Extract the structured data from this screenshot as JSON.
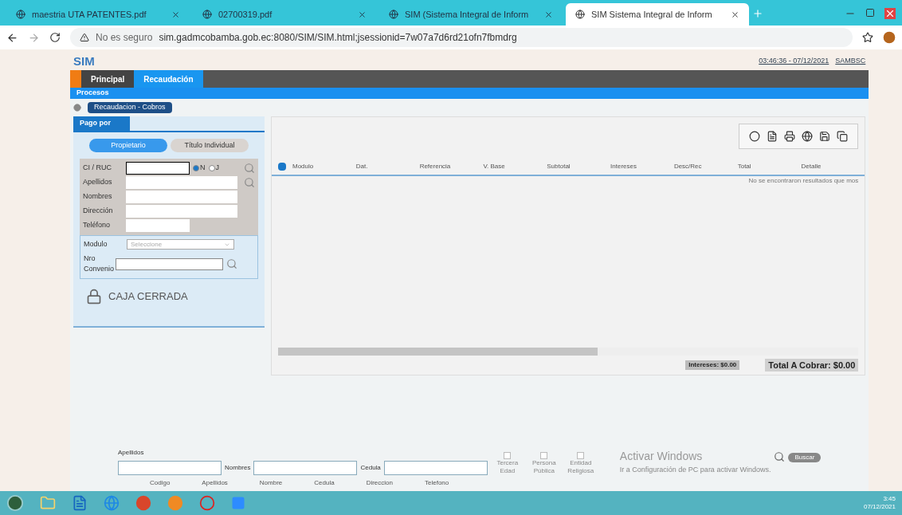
{
  "browser": {
    "tabs": [
      {
        "title": "maestria UTA PATENTES.pdf",
        "selected": false
      },
      {
        "title": "02700319.pdf",
        "selected": false
      },
      {
        "title": "SIM (Sistema Integral de Inform",
        "selected": false
      },
      {
        "title": "SIM Sistema Integral de Inform",
        "selected": true
      }
    ],
    "security": "No es seguro",
    "url": "sim.gadmcobamba.gob.ec:8080/SIM/SIM.html;jsessionid=7w07a7d6rd21ofn7fbmdrg"
  },
  "app": {
    "logo": "SIM",
    "session": "03:46:36 - 07/12/2021",
    "user": "SAMBSC",
    "main_tabs": [
      {
        "label": "Principal",
        "selected": false
      },
      {
        "label": "Recaudación",
        "selected": true
      }
    ],
    "menu": [
      "Procesos"
    ],
    "breadcrumb": "Recaudacion - Cobros",
    "pay_panel": {
      "title": "Pago por",
      "subtabs": [
        {
          "label": "Propietario",
          "selected": true
        },
        {
          "label": "Título Individual",
          "selected": false
        }
      ],
      "id_label": "CI / RUC",
      "radios": [
        {
          "label": "N",
          "selected": true
        },
        {
          "label": "J",
          "selected": false
        }
      ],
      "fields": [
        {
          "label": "Apellidos"
        },
        {
          "label": "Nombres"
        },
        {
          "label": "Dirección"
        },
        {
          "label": "Teléfono"
        }
      ],
      "module_label": "Modulo",
      "module_placeholder": "Seleccione",
      "number_label": "Nro Convenio",
      "status": "CAJA CERRADA"
    },
    "table": {
      "all_checked": true,
      "columns": [
        "Modulo",
        "Dat.",
        "Referencia",
        "V. Base",
        "Subtotal",
        "Intereses",
        "Desc/Rec",
        "Total",
        "Detalle"
      ],
      "empty": "No se encontraron resultados que mos",
      "interest": "Intereses: $0.00",
      "total": "Total A Cobrar: $0.00"
    },
    "search": {
      "fields": [
        {
          "label": "Apellidos"
        },
        {
          "label": "Nombres"
        },
        {
          "label": "Cedula"
        }
      ],
      "checks": [
        {
          "label": "Tercera Edad",
          "checked": false
        },
        {
          "label": "Persona Pública",
          "checked": false
        },
        {
          "label": "Entidad Religiosa",
          "checked": false
        }
      ],
      "button": "Buscar",
      "columns": [
        "Codigo",
        "Apellidos",
        "Nombre",
        "Cedula",
        "Direccion",
        "Telefono"
      ]
    }
  },
  "watermark": {
    "title": "Activar Windows",
    "subtitle": "Ir a Configuración de PC para activar Windows."
  },
  "taskbar": {
    "time": "3:45",
    "date": "07/12/2021"
  }
}
